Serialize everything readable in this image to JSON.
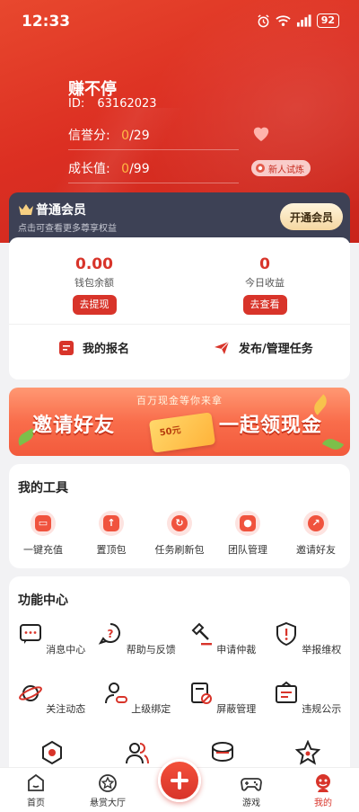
{
  "status_bar": {
    "time": "12:33",
    "battery": "92"
  },
  "profile": {
    "username": "赚不停",
    "id_label": "ID:",
    "id_value": "63162023",
    "credit_label": "信誉分:",
    "credit_value": "0",
    "credit_total": "/29",
    "growth_label": "成长值:",
    "growth_value": "0",
    "growth_total": "/99",
    "newbie_badge": "新人试炼"
  },
  "vip": {
    "title": "普通会员",
    "subtitle": "点击可查看更多尊享权益",
    "button": "开通会员"
  },
  "wallet": {
    "balance_value": "0.00",
    "balance_label": "钱包余额",
    "withdraw_button": "去提现",
    "today_value": "0",
    "today_label": "今日收益",
    "view_button": "去查看",
    "my_signups": "我的报名",
    "publish_tasks": "发布/管理任务"
  },
  "banner": {
    "top_text": "百万现金等你来拿",
    "left_text": "邀请好友",
    "right_text": "一起领现金",
    "chip_text": "50元"
  },
  "tools": {
    "title": "我的工具",
    "items": [
      {
        "label": "一键充值",
        "icon": "recharge-icon"
      },
      {
        "label": "置顶包",
        "icon": "pin-top-icon"
      },
      {
        "label": "任务刷新包",
        "icon": "refresh-icon"
      },
      {
        "label": "团队管理",
        "icon": "team-icon"
      },
      {
        "label": "邀请好友",
        "icon": "share-icon"
      }
    ]
  },
  "functions": {
    "title": "功能中心",
    "items": [
      {
        "label": "消息中心",
        "icon": "message-icon"
      },
      {
        "label": "帮助与反馈",
        "icon": "help-icon"
      },
      {
        "label": "申请仲裁",
        "icon": "gavel-icon"
      },
      {
        "label": "举报维权",
        "icon": "shield-alert-icon"
      },
      {
        "label": "关注动态",
        "icon": "planet-icon"
      },
      {
        "label": "上级绑定",
        "icon": "user-link-icon"
      },
      {
        "label": "屏蔽管理",
        "icon": "block-doc-icon"
      },
      {
        "label": "违规公示",
        "icon": "notice-board-icon"
      }
    ]
  },
  "bottom_nav": {
    "items": [
      {
        "label": "首页",
        "icon": "home-icon"
      },
      {
        "label": "悬赏大厅",
        "icon": "star-icon"
      },
      {
        "label": "游戏",
        "icon": "gamepad-icon"
      },
      {
        "label": "我的",
        "icon": "profile-icon"
      }
    ],
    "active": "我的"
  },
  "colors": {
    "primary": "#d8342a",
    "vip_bg": "#3d4155",
    "accent": "#ffb53a"
  }
}
